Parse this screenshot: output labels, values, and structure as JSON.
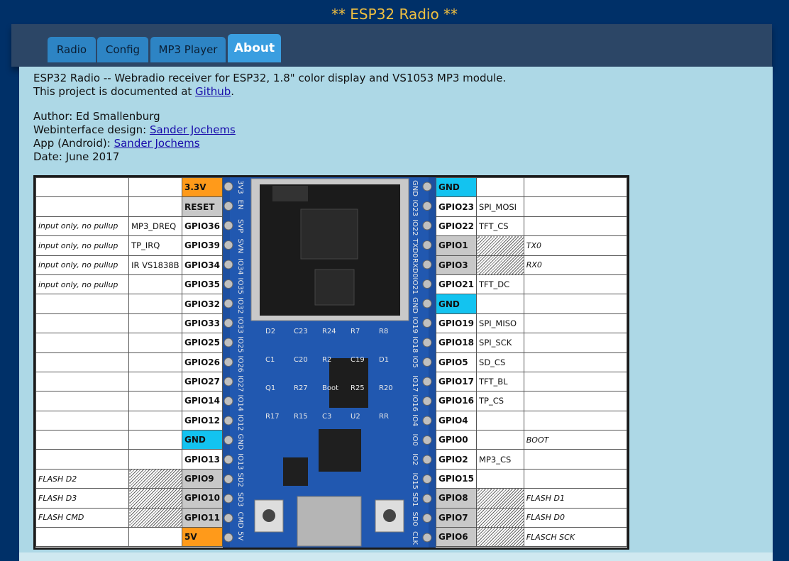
{
  "page_title": "** ESP32 Radio **",
  "tabs": [
    {
      "label": "Radio",
      "active": false
    },
    {
      "label": "Config",
      "active": false
    },
    {
      "label": "MP3 Player",
      "active": false
    },
    {
      "label": "About",
      "active": true
    }
  ],
  "about": {
    "line1": "ESP32 Radio -- Webradio receiver for ESP32, 1.8\" color display and VS1053 MP3 module.",
    "line2_prefix": "This project is documented at ",
    "line2_link": "Github",
    "line2_suffix": ".",
    "author": "Author: Ed Smallenburg",
    "web_prefix": "Webinterface design: ",
    "web_link": "Sander Jochems",
    "app_prefix": "App (Android): ",
    "app_link": "Sander Jochems",
    "date": "Date: June 2017"
  },
  "colors": {
    "background": "#003068",
    "title": "#f0c040",
    "content": "#add8e6",
    "tab": "#2d84c4",
    "tab_active": "#3a9ee0",
    "power": "#ff9a1a",
    "ground": "#13c3f0",
    "reserved": "#c8c8c8"
  },
  "board_image": {
    "description": "ESP32 module board photo",
    "labels": [
      "3V3",
      "EN",
      "SVP",
      "SVN",
      "IO34",
      "IO35",
      "IO32",
      "IO33",
      "IO25",
      "IO26",
      "IO27",
      "IO14",
      "IO12",
      "GND",
      "IO13",
      "SD2",
      "SD3",
      "CMD",
      "5V",
      "GND",
      "IO23",
      "IO22",
      "TXD0",
      "RXD0",
      "IO21",
      "GND",
      "IO19",
      "IO18",
      "IO5",
      "IO17",
      "IO16",
      "IO4",
      "IO0",
      "IO2",
      "IO15",
      "SD1",
      "SD0",
      "CLK",
      "D2",
      "C23",
      "R24",
      "R7",
      "R8",
      "C1",
      "C20",
      "R2",
      "C19",
      "D1",
      "Q1",
      "R27",
      "Boot",
      "R25",
      "R20",
      "R17",
      "R15",
      "C3",
      "U2",
      "RR"
    ]
  },
  "left_rows": [
    {
      "note": "",
      "func": "",
      "gpio": "3.3V",
      "style": "orange"
    },
    {
      "note": "",
      "func": "",
      "gpio": "RESET",
      "style": "gray"
    },
    {
      "note": "input only, no pullup",
      "func": "MP3_DREQ",
      "gpio": "GPIO36",
      "style": ""
    },
    {
      "note": "input only, no pullup",
      "func": "TP_IRQ",
      "gpio": "GPIO39",
      "style": ""
    },
    {
      "note": "input only, no pullup",
      "func": "IR  VS1838B",
      "gpio": "GPIO34",
      "style": ""
    },
    {
      "note": "input only, no pullup",
      "func": "",
      "gpio": "GPIO35",
      "style": ""
    },
    {
      "note": "",
      "func": "",
      "gpio": "GPIO32",
      "style": ""
    },
    {
      "note": "",
      "func": "",
      "gpio": "GPIO33",
      "style": ""
    },
    {
      "note": "",
      "func": "",
      "gpio": "GPIO25",
      "style": ""
    },
    {
      "note": "",
      "func": "",
      "gpio": "GPIO26",
      "style": ""
    },
    {
      "note": "",
      "func": "",
      "gpio": "GPIO27",
      "style": ""
    },
    {
      "note": "",
      "func": "",
      "gpio": "GPIO14",
      "style": ""
    },
    {
      "note": "",
      "func": "",
      "gpio": "GPIO12",
      "style": ""
    },
    {
      "note": "",
      "func": "",
      "gpio": "GND",
      "style": "cyan"
    },
    {
      "note": "",
      "func": "",
      "gpio": "GPIO13",
      "style": ""
    },
    {
      "note": "FLASH D2",
      "func": "",
      "gpio": "GPIO9",
      "style": "gray",
      "hatch": true
    },
    {
      "note": "FLASH D3",
      "func": "",
      "gpio": "GPIO10",
      "style": "gray",
      "hatch": true
    },
    {
      "note": "FLASH CMD",
      "func": "",
      "gpio": "GPIO11",
      "style": "gray",
      "hatch": true
    },
    {
      "note": "",
      "func": "",
      "gpio": "5V",
      "style": "orange"
    }
  ],
  "right_rows": [
    {
      "gpio": "GND",
      "func": "",
      "note": "",
      "style": "cyan"
    },
    {
      "gpio": "GPIO23",
      "func": "SPI_MOSI",
      "note": "",
      "style": ""
    },
    {
      "gpio": "GPIO22",
      "func": "TFT_CS",
      "note": "",
      "style": ""
    },
    {
      "gpio": "GPIO1",
      "func": "",
      "note": "TX0",
      "style": "gray",
      "hatch": true
    },
    {
      "gpio": "GPIO3",
      "func": "",
      "note": "RX0",
      "style": "gray",
      "hatch": true
    },
    {
      "gpio": "GPIO21",
      "func": "TFT_DC",
      "note": "",
      "style": ""
    },
    {
      "gpio": "GND",
      "func": "",
      "note": "",
      "style": "cyan"
    },
    {
      "gpio": "GPIO19",
      "func": "SPI_MISO",
      "note": "",
      "style": ""
    },
    {
      "gpio": "GPIO18",
      "func": "SPI_SCK",
      "note": "",
      "style": ""
    },
    {
      "gpio": "GPIO5",
      "func": "SD_CS",
      "note": "",
      "style": ""
    },
    {
      "gpio": "GPIO17",
      "func": "TFT_BL",
      "note": "",
      "style": ""
    },
    {
      "gpio": "GPIO16",
      "func": "TP_CS",
      "note": "",
      "style": ""
    },
    {
      "gpio": "GPIO4",
      "func": "",
      "note": "",
      "style": ""
    },
    {
      "gpio": "GPIO0",
      "func": "",
      "note": "BOOT",
      "style": ""
    },
    {
      "gpio": "GPIO2",
      "func": "MP3_CS",
      "note": "",
      "style": ""
    },
    {
      "gpio": "GPIO15",
      "func": "",
      "note": "",
      "style": ""
    },
    {
      "gpio": "GPIO8",
      "func": "",
      "note": "FLASH D1",
      "style": "gray",
      "hatch": true
    },
    {
      "gpio": "GPIO7",
      "func": "",
      "note": "FLASH D0",
      "style": "gray",
      "hatch": true
    },
    {
      "gpio": "GPIO6",
      "func": "",
      "note": "FLASCH SCK",
      "style": "gray",
      "hatch": true
    }
  ]
}
